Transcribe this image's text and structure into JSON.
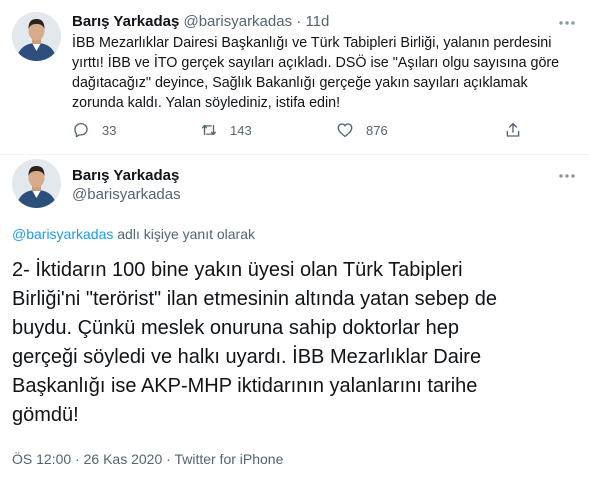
{
  "parent_tweet": {
    "name": "Barış Yarkadaş",
    "handle": "@barisyarkadas",
    "separator": "·",
    "time": "11d",
    "text_lines": [
      "İBB Mezarlıklar Dairesi Başkanlığı ve Türk Tabipleri Birliği, yalanın perdesini",
      "yırttı! İBB ve İTO gerçek sayıları açıkladı. DSÖ ise \"Aşıları olgu sayısına göre",
      "dağıtacağız\" deyince, Sağlık Bakanlığı gerçeğe yakın sayıları açıklamak",
      "zorunda kaldı. Yalan söylediniz, istifa edin!"
    ],
    "actions": {
      "reply_count": "33",
      "retweet_count": "143",
      "like_count": "876"
    },
    "icons": [
      "reply-icon",
      "retweet-icon",
      "like-icon",
      "share-icon",
      "more-icon"
    ]
  },
  "main_tweet": {
    "name": "Barış Yarkadaş",
    "handle": "@barisyarkadas",
    "reply_mention": "@barisyarkadas",
    "reply_suffix": " adlı kişiye yanıt olarak",
    "text_lines": [
      "2- İktidarın 100 bine yakın üyesi olan Türk Tabipleri",
      "Birliği'ni \"terörist\" ilan etmesinin altında yatan sebep de",
      "buydu. Çünkü meslek onuruna sahip doktorlar hep",
      "gerçeği söyledi ve halkı uyardı. İBB Mezarlıklar Daire",
      "Başkanlığı ise AKP-MHP iktidarının yalanlarını tarihe",
      "gömdü!"
    ],
    "time": "ÖS 12:00",
    "date": "26 Kas 2020",
    "meta_separator": "·",
    "source": "Twitter for iPhone"
  },
  "colors": {
    "text": "#0f1419",
    "muted": "#536471",
    "link": "#1d9bf0",
    "divider": "#eff3f4"
  }
}
